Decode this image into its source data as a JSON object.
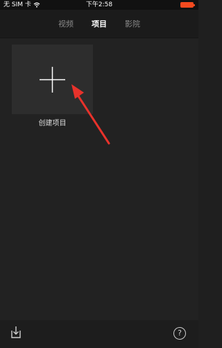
{
  "status_bar": {
    "carrier": "无 SIM 卡",
    "time": "下午2:58",
    "battery_color": "#f44a1f"
  },
  "tabs": [
    {
      "label": "视频",
      "active": false
    },
    {
      "label": "项目",
      "active": true
    },
    {
      "label": "影院",
      "active": false
    }
  ],
  "create_project": {
    "label": "创建项目",
    "icon": "plus-icon"
  },
  "annotation": {
    "icon": "red-arrow-icon",
    "color": "#e8322b"
  },
  "bottom_bar": {
    "left_icon": "import-icon",
    "help_label": "?"
  }
}
